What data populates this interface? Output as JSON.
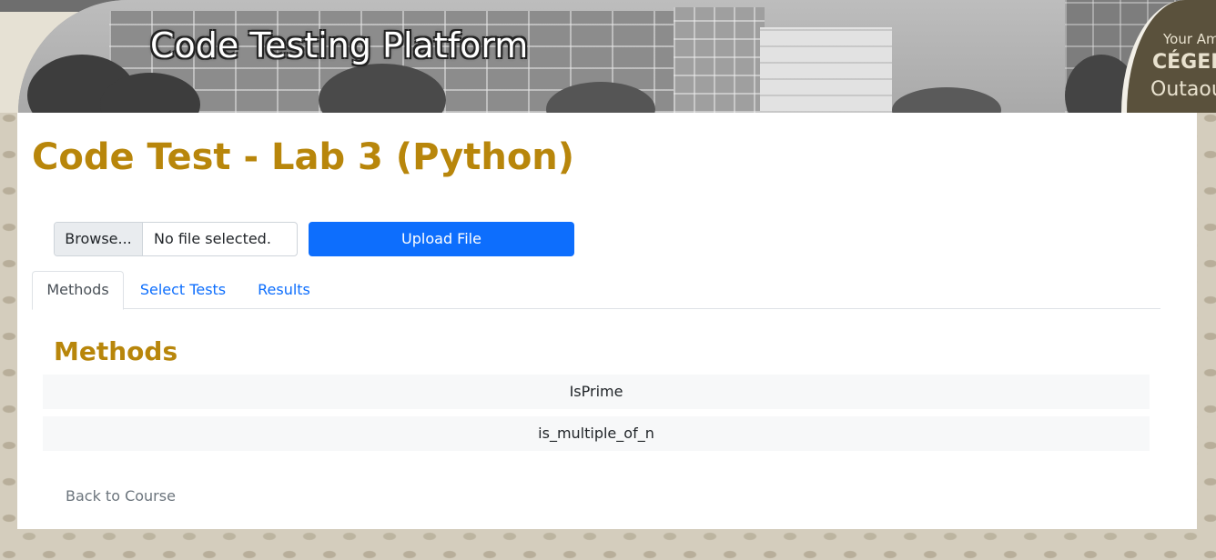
{
  "banner": {
    "title": "Code Testing Platform",
    "logo_line1": "Your Am",
    "logo_line2": "CÉGEP",
    "logo_line3": "Outaou"
  },
  "page": {
    "title": "Code Test - Lab 3 (Python)"
  },
  "upload": {
    "browse_label": "Browse...",
    "file_status": "No file selected.",
    "upload_button_label": "Upload File"
  },
  "tabs": [
    {
      "label": "Methods",
      "active": true
    },
    {
      "label": "Select Tests",
      "active": false
    },
    {
      "label": "Results",
      "active": false
    }
  ],
  "methods_section": {
    "title": "Methods",
    "items": [
      "IsPrime",
      "is_multiple_of_n"
    ]
  },
  "footer": {
    "back_link": "Back to Course"
  },
  "colors": {
    "heading": "#b8860b",
    "primary": "#0d6efd",
    "link_muted": "#6c757d",
    "logo_panel": "#5a513c"
  }
}
